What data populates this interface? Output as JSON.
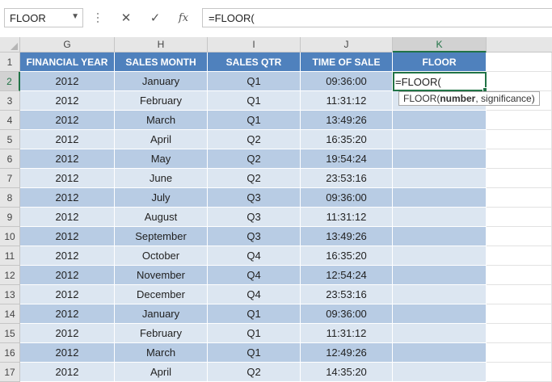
{
  "formula_bar": {
    "name_box": "FLOOR",
    "cancel_icon": "✕",
    "enter_icon": "✓",
    "fx_label": "fx",
    "formula": "=FLOOR("
  },
  "columns": [
    "G",
    "H",
    "I",
    "J",
    "K"
  ],
  "headers": [
    "FINANCIAL YEAR",
    "SALES MONTH",
    "SALES QTR",
    "TIME OF SALE",
    "FLOOR"
  ],
  "rows": [
    {
      "num": "1"
    },
    {
      "num": "2",
      "cells": [
        "2012",
        "January",
        "Q1",
        "09:36:00",
        "=FLOOR("
      ]
    },
    {
      "num": "3",
      "cells": [
        "2012",
        "February",
        "Q1",
        "11:31:12",
        ""
      ]
    },
    {
      "num": "4",
      "cells": [
        "2012",
        "March",
        "Q1",
        "13:49:26",
        ""
      ]
    },
    {
      "num": "5",
      "cells": [
        "2012",
        "April",
        "Q2",
        "16:35:20",
        ""
      ]
    },
    {
      "num": "6",
      "cells": [
        "2012",
        "May",
        "Q2",
        "19:54:24",
        ""
      ]
    },
    {
      "num": "7",
      "cells": [
        "2012",
        "June",
        "Q2",
        "23:53:16",
        ""
      ]
    },
    {
      "num": "8",
      "cells": [
        "2012",
        "July",
        "Q3",
        "09:36:00",
        ""
      ]
    },
    {
      "num": "9",
      "cells": [
        "2012",
        "August",
        "Q3",
        "11:31:12",
        ""
      ]
    },
    {
      "num": "10",
      "cells": [
        "2012",
        "September",
        "Q3",
        "13:49:26",
        ""
      ]
    },
    {
      "num": "11",
      "cells": [
        "2012",
        "October",
        "Q4",
        "16:35:20",
        ""
      ]
    },
    {
      "num": "12",
      "cells": [
        "2012",
        "November",
        "Q4",
        "12:54:24",
        ""
      ]
    },
    {
      "num": "13",
      "cells": [
        "2012",
        "December",
        "Q4",
        "23:53:16",
        ""
      ]
    },
    {
      "num": "14",
      "cells": [
        "2012",
        "January",
        "Q1",
        "09:36:00",
        ""
      ]
    },
    {
      "num": "15",
      "cells": [
        "2012",
        "February",
        "Q1",
        "11:31:12",
        ""
      ]
    },
    {
      "num": "16",
      "cells": [
        "2012",
        "March",
        "Q1",
        "12:49:26",
        ""
      ]
    },
    {
      "num": "17",
      "cells": [
        "2012",
        "April",
        "Q2",
        "14:35:20",
        ""
      ]
    }
  ],
  "tooltip": {
    "func": "FLOOR(",
    "arg1": "number",
    "rest": ", significance)"
  },
  "colors": {
    "header_fill": "#4f81bd",
    "band_dark": "#b8cce4",
    "band_light": "#dce6f1",
    "selection": "#217346"
  }
}
